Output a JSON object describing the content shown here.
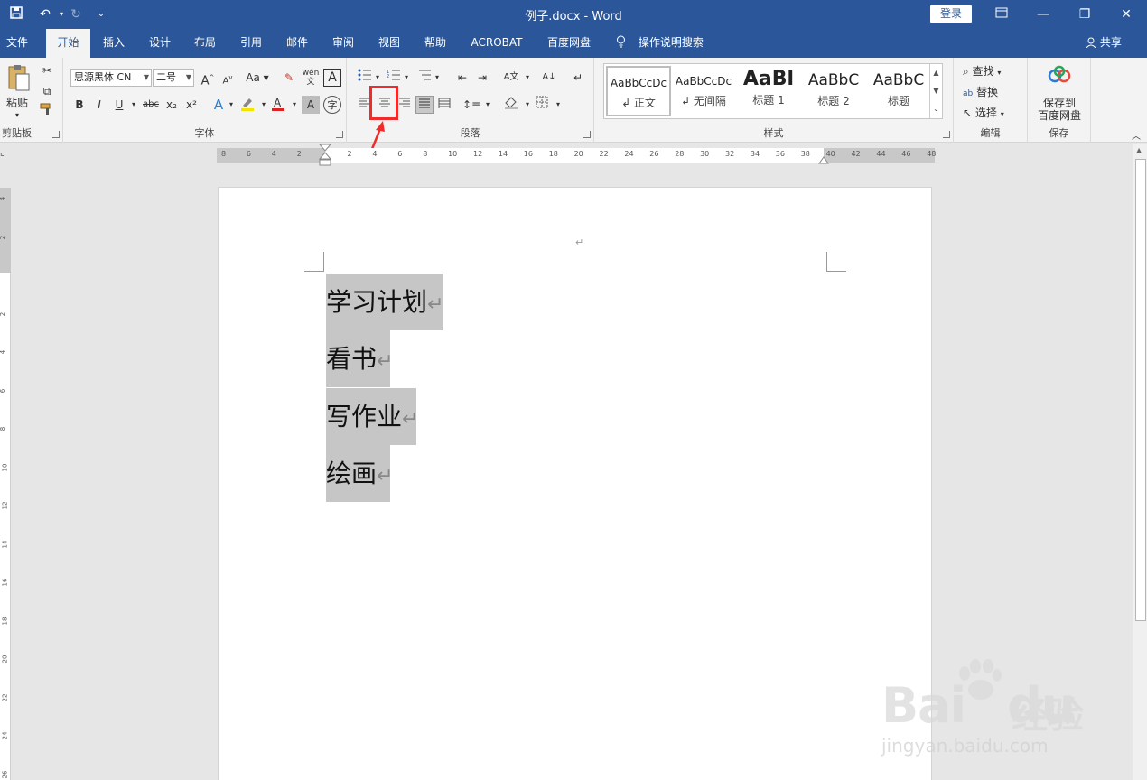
{
  "window": {
    "title": "例子.docx  -  Word",
    "login_label": "登录",
    "colors": {
      "titlebar": "#2b579a",
      "highlight": "#ef2b2b"
    }
  },
  "quick_access": {
    "save_icon": "save-icon",
    "undo_icon": "undo-icon",
    "redo_icon": "redo-icon",
    "customize_icon": "chevron-down-icon"
  },
  "tabs": [
    {
      "label": "文件",
      "active": false
    },
    {
      "label": "开始",
      "active": true
    },
    {
      "label": "插入",
      "active": false
    },
    {
      "label": "设计",
      "active": false
    },
    {
      "label": "布局",
      "active": false
    },
    {
      "label": "引用",
      "active": false
    },
    {
      "label": "邮件",
      "active": false
    },
    {
      "label": "审阅",
      "active": false
    },
    {
      "label": "视图",
      "active": false
    },
    {
      "label": "帮助",
      "active": false
    },
    {
      "label": "ACROBAT",
      "active": false
    },
    {
      "label": "百度网盘",
      "active": false
    }
  ],
  "tell_me": "操作说明搜索",
  "share": "共享",
  "ribbon": {
    "clipboard": {
      "label": "剪贴板",
      "paste_label": "粘贴"
    },
    "font": {
      "label": "字体",
      "font_name": "思源黑体 CN",
      "font_size": "二号",
      "aa_label": "Aa",
      "wen_label": "wén",
      "bold": "B",
      "italic": "I",
      "underline": "U",
      "strike": "abc",
      "sub": "x₂",
      "sup": "x²",
      "a_big": "A",
      "a_small": "A",
      "char_border": "A"
    },
    "paragraph": {
      "label": "段落"
    },
    "styles": {
      "label": "样式",
      "items": [
        {
          "sample": "AaBbCcDc",
          "name": "↲ 正文"
        },
        {
          "sample": "AaBbCcDc",
          "name": "↲ 无间隔"
        },
        {
          "sample": "AaBl",
          "name": "标题 1"
        },
        {
          "sample": "AaBbC",
          "name": "标题 2"
        },
        {
          "sample": "AaBbC",
          "name": "标题"
        }
      ]
    },
    "editing": {
      "label": "编辑",
      "find": "查找",
      "replace": "替换",
      "select": "选择"
    },
    "save": {
      "label": "保存",
      "save_to": "保存到",
      "baidu": "百度网盘"
    }
  },
  "ruler": {
    "h_ticks": [
      "8",
      "6",
      "4",
      "2",
      "2",
      "4",
      "6",
      "8",
      "10",
      "12",
      "14",
      "16",
      "18",
      "20",
      "22",
      "24",
      "26",
      "28",
      "30",
      "32",
      "34",
      "36",
      "38",
      "40",
      "42",
      "44",
      "46",
      "48"
    ],
    "v_ticks": [
      "4",
      "2",
      "2",
      "4",
      "6",
      "8",
      "10",
      "12",
      "14",
      "16",
      "18",
      "20",
      "22",
      "24",
      "26"
    ]
  },
  "document": {
    "header_mark": "↵",
    "paragraphs": [
      "学习计划",
      "看书",
      "写作业",
      "绘画"
    ],
    "para_mark": "↵"
  },
  "watermark": {
    "brand": "Bai",
    "brand2": "du",
    "jingyan": "经验",
    "url": "jingyan.baidu.com"
  }
}
